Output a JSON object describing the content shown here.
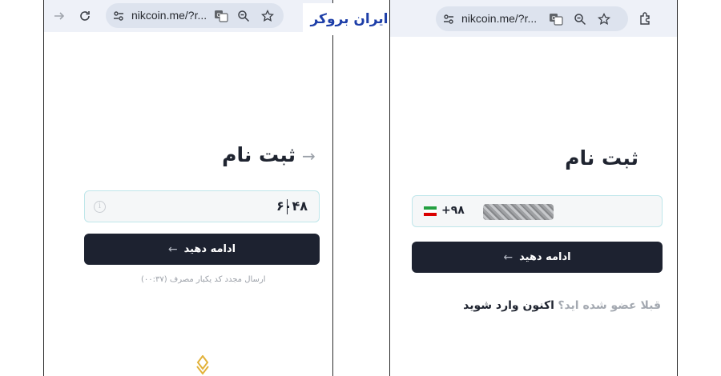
{
  "brand": {
    "text": "ایران بروکر",
    "color": "#1d3ea8"
  },
  "left": {
    "browser": {
      "url": "nikcoin.me/?r...",
      "icons": [
        "forward-arrow-icon",
        "reload-icon",
        "site-settings-icon",
        "translate-icon",
        "zoom-icon",
        "bookmark-star-icon"
      ]
    },
    "page": {
      "title": "ثبت نام",
      "code_input_value": "۶۰۴۸",
      "continue_label": "ادامه دهید",
      "resend_text": "ارسال مجدد کد یکبار مصرف (۰۰:۳۷)"
    }
  },
  "right": {
    "browser": {
      "url": "nikcoin.me/?r...",
      "icons": [
        "site-settings-icon",
        "translate-icon",
        "zoom-icon",
        "bookmark-star-icon",
        "extensions-icon"
      ]
    },
    "page": {
      "title": "ثبت نام",
      "phone_prefix": "+۹۸",
      "continue_label": "ادامه دهید",
      "already_member": "قبلا عضو شده اید؟",
      "login_now": "اکنون وارد شوید"
    }
  },
  "colors": {
    "button": "#1d2230",
    "input_border": "#bfe6ea",
    "toolbar": "#eef1f8"
  }
}
